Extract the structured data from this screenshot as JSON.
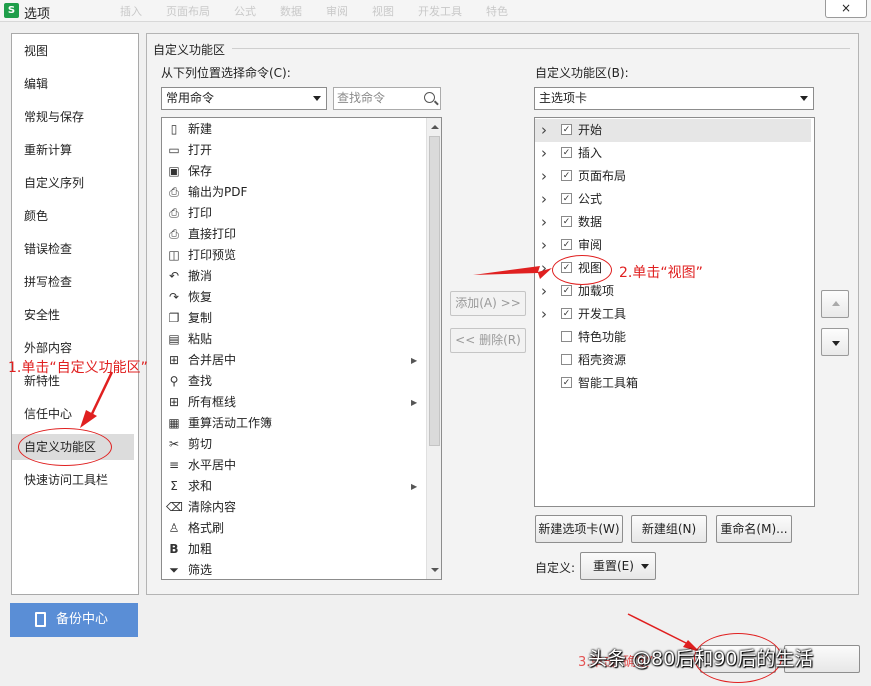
{
  "window": {
    "title": "选项",
    "app_icon": "S",
    "close": "×",
    "background_tabs": [
      "",
      "插入",
      "页面布局",
      "公式",
      "数据",
      "审阅",
      "视图",
      "开发工具",
      "特色"
    ]
  },
  "nav": {
    "items": [
      "视图",
      "编辑",
      "常规与保存",
      "重新计算",
      "自定义序列",
      "颜色",
      "错误检查",
      "拼写检查",
      "安全性",
      "外部内容",
      "新特性",
      "信任中心",
      "自定义功能区",
      "快速访问工具栏"
    ],
    "selected": 12
  },
  "main": {
    "group_title": "自定义功能区",
    "left": {
      "label": "从下列位置选择命令(C):",
      "source": "常用命令",
      "search_placeholder": "查找命令",
      "commands": [
        {
          "icon": "new-icon",
          "glyph": "▯",
          "label": "新建"
        },
        {
          "icon": "open-icon",
          "glyph": "▭",
          "label": "打开"
        },
        {
          "icon": "save-icon",
          "glyph": "▣",
          "label": "保存"
        },
        {
          "icon": "pdf-icon",
          "glyph": "⎙",
          "label": "输出为PDF"
        },
        {
          "icon": "print-icon",
          "glyph": "⎙",
          "label": "打印"
        },
        {
          "icon": "print-direct-icon",
          "glyph": "⎙",
          "label": "直接打印"
        },
        {
          "icon": "print-preview-icon",
          "glyph": "◫",
          "label": "打印预览"
        },
        {
          "icon": "undo-icon",
          "glyph": "↶",
          "label": "撤消"
        },
        {
          "icon": "redo-icon",
          "glyph": "↷",
          "label": "恢复"
        },
        {
          "icon": "copy-icon",
          "glyph": "❐",
          "label": "复制"
        },
        {
          "icon": "paste-icon",
          "glyph": "▤",
          "label": "粘贴"
        },
        {
          "icon": "merge-center-icon",
          "glyph": "⊞",
          "label": "合并居中",
          "submenu": true
        },
        {
          "icon": "find-icon",
          "glyph": "⚲",
          "label": "查找"
        },
        {
          "icon": "borders-icon",
          "glyph": "⊞",
          "label": "所有框线",
          "submenu": true
        },
        {
          "icon": "recalc-icon",
          "glyph": "▦",
          "label": "重算活动工作簿"
        },
        {
          "icon": "cut-icon",
          "glyph": "✂",
          "label": "剪切"
        },
        {
          "icon": "align-center-icon",
          "glyph": "≡",
          "label": "水平居中"
        },
        {
          "icon": "sum-icon",
          "glyph": "Σ",
          "label": "求和",
          "submenu": true
        },
        {
          "icon": "clear-icon",
          "glyph": "⌫",
          "label": "清除内容"
        },
        {
          "icon": "format-painter-icon",
          "glyph": "♙",
          "label": "格式刷"
        },
        {
          "icon": "bold-icon",
          "glyph": "B",
          "label": "加粗"
        },
        {
          "icon": "filter-icon",
          "glyph": "⏷",
          "label": "筛选"
        }
      ]
    },
    "add_button": "添加(A) >>",
    "remove_button": "<< 删除(R)",
    "right": {
      "label": "自定义功能区(B):",
      "scope": "主选项卡",
      "tabs": [
        {
          "label": "开始",
          "checked": true,
          "expandable": true
        },
        {
          "label": "插入",
          "checked": true,
          "expandable": true
        },
        {
          "label": "页面布局",
          "checked": true,
          "expandable": true
        },
        {
          "label": "公式",
          "checked": true,
          "expandable": true
        },
        {
          "label": "数据",
          "checked": true,
          "expandable": true
        },
        {
          "label": "审阅",
          "checked": true,
          "expandable": true
        },
        {
          "label": "视图",
          "checked": true,
          "expandable": true
        },
        {
          "label": "加载项",
          "checked": true,
          "expandable": true
        },
        {
          "label": "开发工具",
          "checked": true,
          "expandable": true
        },
        {
          "label": "特色功能",
          "checked": false,
          "expandable": false
        },
        {
          "label": "稻壳资源",
          "checked": false,
          "expandable": false
        },
        {
          "label": "智能工具箱",
          "checked": true,
          "expandable": false
        }
      ],
      "selected": 0
    },
    "new_tab_button": "新建选项卡(W)",
    "new_group_button": "新建组(N)",
    "rename_button": "重命名(M)...",
    "customize_label": "自定义:",
    "reset_button": "重置(E)"
  },
  "backup_center": "备份中心",
  "annotations": {
    "step1": "1.单击“自定义功能区”",
    "step2": "2.单击“视图”",
    "step3": "3.单击“确定”",
    "watermark": "头条 @80后和90后的生活",
    "color": "#e02020"
  }
}
